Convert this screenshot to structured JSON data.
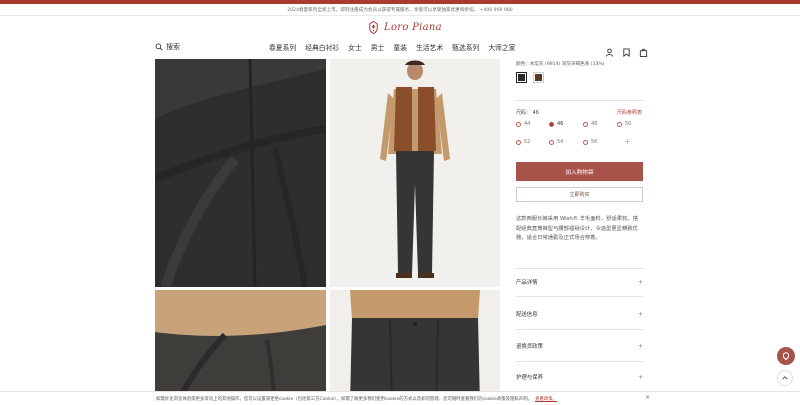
{
  "announcement": "2024春夏系列全新上市。即刻注册成为会员以获得专属服务，享受可以享受独家优惠和折扣。 +400 969 980",
  "brand": {
    "logo_text": "Loro Piana",
    "accent": "#a83a32"
  },
  "header": {
    "search_label": "搜索",
    "nav": [
      "春夏系列",
      "经典白衬衫",
      "女士",
      "男士",
      "童装",
      "生活艺术",
      "甄选系列",
      "大师之家"
    ]
  },
  "product": {
    "meta_line": "颜色：木炭灰 (9914)   深灰深褐色系 (13%)",
    "colors": [
      "#2a2a2a",
      "#5a3a22"
    ],
    "size_label": "尺码： 46",
    "size_guide": "尺码参照表",
    "sizes": [
      "44",
      "46",
      "48",
      "50",
      "52",
      "54",
      "56"
    ],
    "selected_size": "46",
    "add_to_bag": "加入购物袋",
    "secondary_button": "立即购买",
    "description": "这款西服长裤采用 Wish® 羊毛面料，舒适柔软。搭配经典直筒裤型与腰部褶裥设计，令造型更显精致优雅，适合日常通勤及正式场合穿着。",
    "sections": [
      "产品详情",
      "配送信息",
      "退换货政策",
      "护理与保养"
    ]
  },
  "cookie": {
    "text": "如需优化浏览体验或更多资讯上的其他操作，您可以设置或拒绝cookie（包括第三方Cookie）。如需了解更多我们使用cookie的方式以及如何管理，您可随时查看我们的cookie政策及隐私声明。",
    "link": "查看政策。"
  }
}
